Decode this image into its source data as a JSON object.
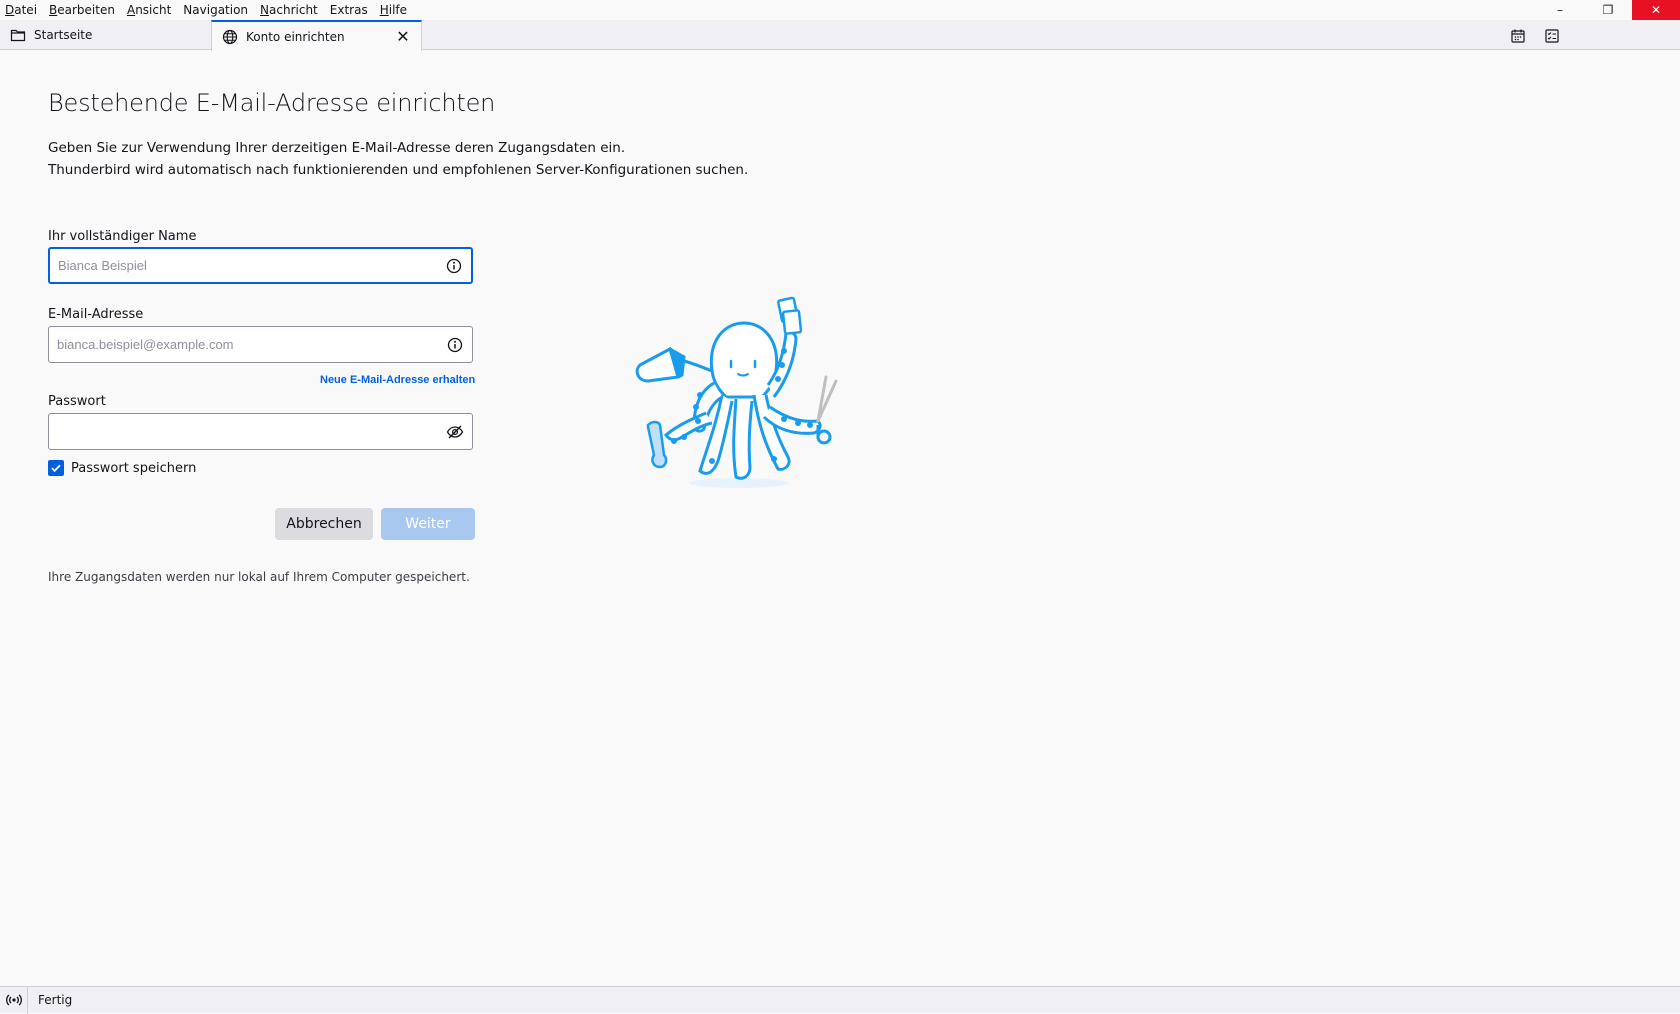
{
  "menubar": {
    "items": [
      {
        "label": "Datei",
        "accel": "D",
        "rest": "atei"
      },
      {
        "label": "Bearbeiten",
        "accel": "B",
        "rest": "earbeiten"
      },
      {
        "label": "Ansicht",
        "accel": "A",
        "rest": "nsicht"
      },
      {
        "label": "Navigation",
        "accel": "N",
        "rest": "avigation",
        "pre": ""
      },
      {
        "label": "Nachricht",
        "accel": "N",
        "rest": "achricht"
      },
      {
        "label": "Extras",
        "accel": "E",
        "rest": "xtras"
      },
      {
        "label": "Hilfe",
        "accel": "H",
        "rest": "ilfe"
      }
    ],
    "window_controls": {
      "minimize": "–",
      "restore": "❐",
      "close": "✕"
    }
  },
  "tabs": {
    "home_label": "Startseite",
    "active_label": "Konto einrichten",
    "close_glyph": "✕"
  },
  "page": {
    "title": "Bestehende E-Mail-Adresse einrichten",
    "intro_line1": "Geben Sie zur Verwendung Ihrer derzeitigen E-Mail-Adresse deren Zugangsdaten ein.",
    "intro_line2": "Thunderbird wird automatisch nach funktionierenden und empfohlenen Server-Konfigurationen suchen."
  },
  "form": {
    "name_label": "Ihr vollständiger Name",
    "name_placeholder": "Bianca Beispiel",
    "name_value": "",
    "email_label": "E-Mail-Adresse",
    "email_placeholder": "bianca.beispiel@example.com",
    "email_value": "",
    "new_address_link": "Neue E-Mail-Adresse erhalten",
    "password_label": "Passwort",
    "password_value": "",
    "remember_label": "Passwort speichern",
    "remember_checked": true,
    "cancel_label": "Abbrechen",
    "next_label": "Weiter",
    "footnote": "Ihre Zugangsdaten werden nur lokal auf Ihrem Computer gespeichert."
  },
  "statusbar": {
    "text": "Fertig"
  },
  "colors": {
    "accent": "#0060df",
    "illustration": "#1a9cec"
  }
}
